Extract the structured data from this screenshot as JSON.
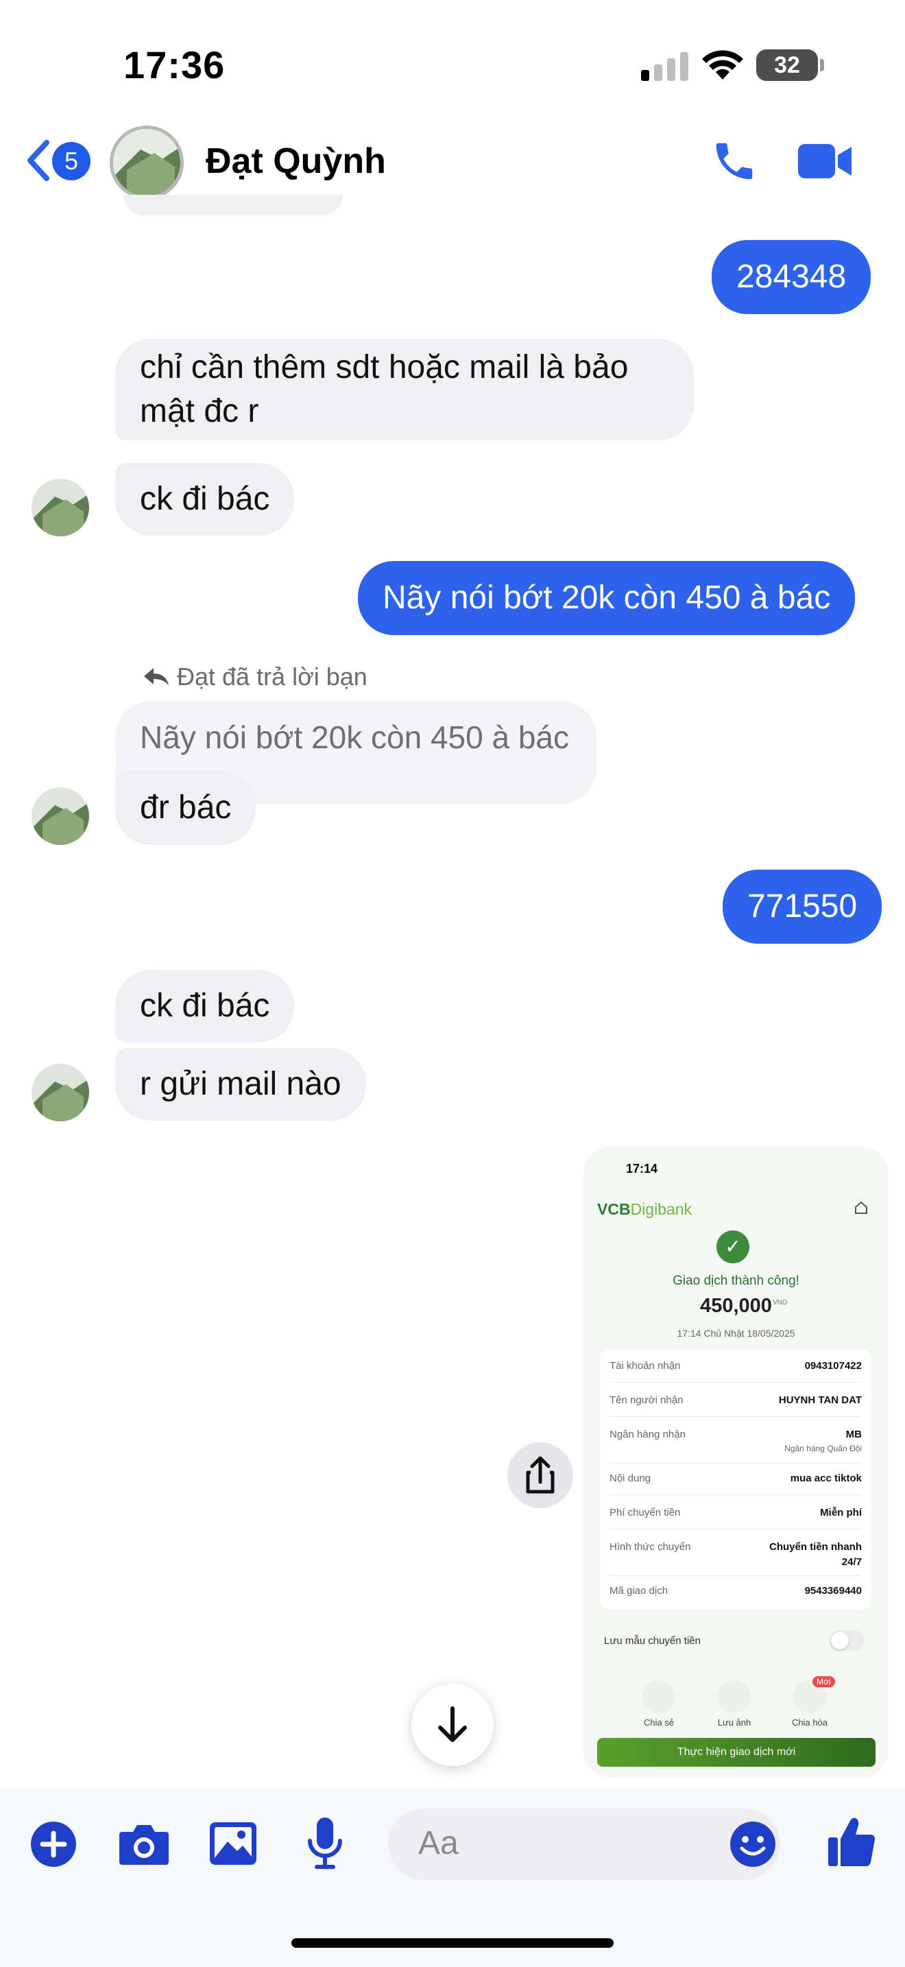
{
  "status_bar": {
    "time": "17:36",
    "battery": "32"
  },
  "header": {
    "back_count": "5",
    "contact_name": "Đạt Quỳnh"
  },
  "messages": {
    "m1": "284348",
    "m2": "chỉ cần thêm sdt hoặc mail là bảo mật đc r",
    "m3": "ck đi bác",
    "m4": "Nãy nói bớt 20k còn 450 à bác",
    "reply_label": "Đạt đã trả lời bạn",
    "quoted": "Nãy nói bớt 20k còn 450 à bác",
    "m5": "đr bác",
    "m6": "771550",
    "m7": "ck đi bác",
    "m8": "r gửi mail nào"
  },
  "receipt": {
    "time": "17:14",
    "brand_prefix": "VCB",
    "brand_suffix": "Digibank",
    "status": "Giao dịch thành công!",
    "amount": "450,000",
    "currency": "VND",
    "datetime": "17:14 Chủ Nhật 18/05/2025",
    "rows": [
      {
        "label": "Tài khoản nhận",
        "value": "0943107422"
      },
      {
        "label": "Tên người nhận",
        "value": "HUYNH TAN DAT"
      },
      {
        "label": "Ngân hàng nhận",
        "value": "MB",
        "sub": "Ngân hàng Quân Đội"
      },
      {
        "label": "Nội dung",
        "value": "mua acc tiktok"
      },
      {
        "label": "Phí chuyển tiền",
        "value": "Miễn phí"
      },
      {
        "label": "Hình thức chuyển",
        "value": "Chuyển tiền nhanh",
        "value2": "24/7"
      },
      {
        "label": "Mã giao dịch",
        "value": "9543369440"
      }
    ],
    "save_template": "Lưu mẫu chuyển tiền",
    "actions": [
      "Chia sẻ",
      "Lưu ảnh",
      "Chia hóa"
    ],
    "new_badge": "Mới",
    "new_transaction": "Thực hiện giao dịch mới"
  },
  "composer": {
    "placeholder": "Aa"
  },
  "colors": {
    "accent": "#2d63ec",
    "icon_blue": "#1f3fc8",
    "incoming_bubble": "#f0f0f2"
  }
}
